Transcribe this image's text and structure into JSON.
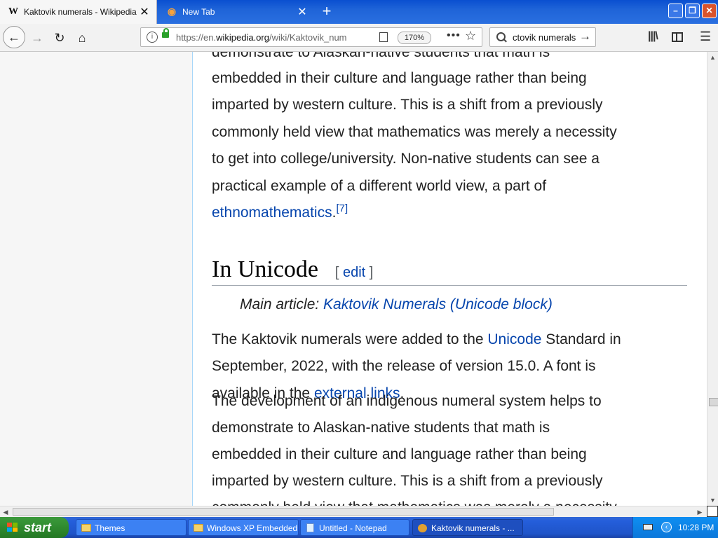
{
  "browser": {
    "tabs": [
      {
        "label": "Kaktovik numerals - Wikipedia",
        "icon": "W"
      },
      {
        "label": "New Tab"
      }
    ],
    "url_prefix": "https://en.",
    "url_domain": "wikipedia.org",
    "url_path": "/wiki/Kaktovik_num",
    "zoom": "170%",
    "search_text": "ctovik numerals"
  },
  "article": {
    "para_top": [
      "demonstrate to Alaskan-native students that math is",
      "embedded in their culture and language rather than being",
      "imparted by western culture. This is a shift from a previously",
      "commonly held view that mathematics was merely a necessity",
      "to get into college/university. Non-native students can see a",
      "practical example of a different world view, a part of"
    ],
    "para_top_link": "ethnomathematics",
    "para_top_end": ".",
    "citation": "[7]",
    "section_heading": "In Unicode",
    "edit_open": "[ ",
    "edit_label": "edit",
    "edit_close": " ]",
    "hatnote_prefix": "Main article: ",
    "hatnote_link": "Kaktovik Numerals (Unicode block)",
    "unicode_para": {
      "line1_pre": "The Kaktovik numerals were added to the ",
      "line1_link": "Unicode",
      "line1_post": " Standard in",
      "line2": "September, 2022, with the release of version 15.0. A font is",
      "line3_pre": "available in the ",
      "line3_link": "external links",
      "line3_post": "."
    },
    "overlap_para": [
      "The development of an indigenous numeral system helps to",
      "demonstrate to Alaskan-native students that math is",
      "embedded in their culture and language rather than being",
      "imparted by western culture. This is a shift from a previously",
      "commonly held view that mathematics was merely a necessity"
    ]
  },
  "taskbar": {
    "start_label": "start",
    "items": [
      {
        "label": "Themes"
      },
      {
        "label": "Windows XP Embedded"
      },
      {
        "label": "Untitled - Notepad"
      },
      {
        "label": "Kaktovik numerals - ..."
      }
    ],
    "clock": "10:28 PM"
  }
}
